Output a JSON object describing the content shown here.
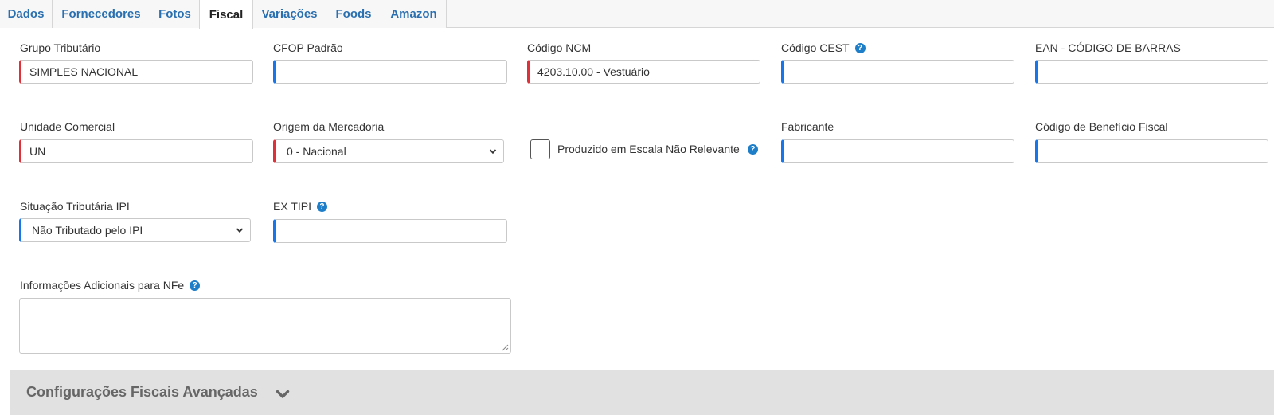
{
  "tabs": [
    {
      "label": "Dados"
    },
    {
      "label": "Fornecedores"
    },
    {
      "label": "Fotos"
    },
    {
      "label": "Fiscal"
    },
    {
      "label": "Variações"
    },
    {
      "label": "Foods"
    },
    {
      "label": "Amazon"
    }
  ],
  "active_tab": "Fiscal",
  "fields": {
    "grupo_tributario": {
      "label": "Grupo Tributário",
      "value": "SIMPLES NACIONAL"
    },
    "cfop_padrao": {
      "label": "CFOP Padrão",
      "value": ""
    },
    "codigo_ncm": {
      "label": "Código NCM",
      "value": "4203.10.00 - Vestuário"
    },
    "codigo_cest": {
      "label": "Código CEST",
      "value": ""
    },
    "ean": {
      "label": "EAN - CÓDIGO DE BARRAS",
      "value": ""
    },
    "unidade_comercial": {
      "label": "Unidade Comercial",
      "value": "UN"
    },
    "origem_mercadoria": {
      "label": "Origem da Mercadoria",
      "value": "0 - Nacional"
    },
    "produzido_escala": {
      "label": "Produzido em Escala Não Relevante",
      "checked": false
    },
    "fabricante": {
      "label": "Fabricante",
      "value": ""
    },
    "beneficio_fiscal": {
      "label": "Código de Benefício Fiscal",
      "value": ""
    },
    "situacao_ipi": {
      "label": "Situação Tributária IPI",
      "value": "Não Tributado pelo IPI"
    },
    "ex_tipi": {
      "label": "EX TIPI",
      "value": ""
    },
    "info_adicionais": {
      "label": "Informações Adicionais para NFe",
      "value": ""
    }
  },
  "advanced": {
    "title": "Configurações Fiscais Avançadas"
  },
  "icons": {
    "help": "question-circle-icon",
    "select": "chevron-down-icon",
    "expand": "chevron-down-icon"
  },
  "colors": {
    "tab_link": "#2a6fb0",
    "required_border": "#e0303a",
    "optional_border": "#1677ea",
    "help_icon": "#1f7ec8",
    "advanced_bg": "#e1e1e1"
  }
}
